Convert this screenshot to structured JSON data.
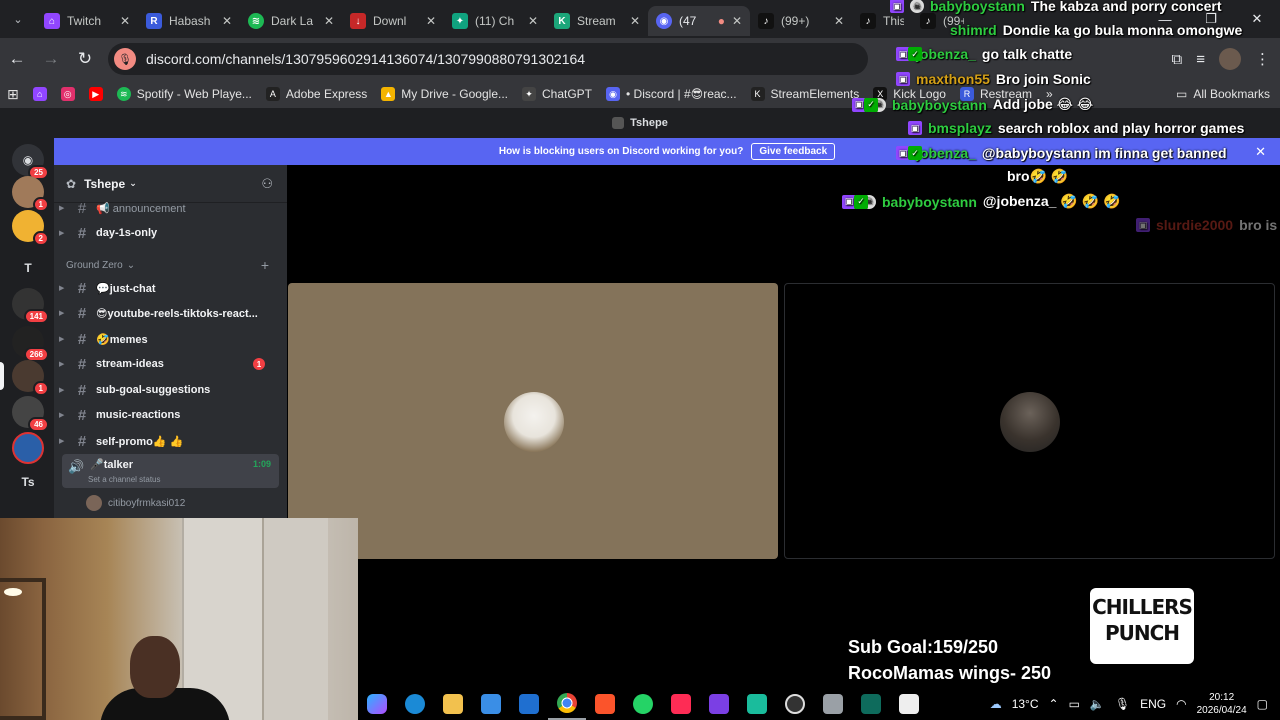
{
  "browser": {
    "tabs": [
      {
        "label": "Twitch",
        "icon": "twitch-icon",
        "color": "#9146ff"
      },
      {
        "label": "Habash",
        "icon": "r-icon",
        "color": "#3b5bdb"
      },
      {
        "label": "Dark La",
        "icon": "spotify-icon",
        "color": "#1db954"
      },
      {
        "label": "Downl",
        "icon": "download-icon",
        "color": "#c62828"
      },
      {
        "label": "(11) Ch",
        "icon": "chatgpt-icon",
        "color": "#10a37f"
      },
      {
        "label": "Stream",
        "icon": "streamelements-icon",
        "color": "#1ca67a"
      },
      {
        "label": "(47",
        "icon": "discord-icon",
        "color": "#5865f2"
      },
      {
        "label": "(99+)",
        "icon": "tiktok-icon",
        "color": "#111111"
      },
      {
        "label": "This th",
        "icon": "tiktok-icon",
        "color": "#111111"
      },
      {
        "label": "(99+)",
        "icon": "tiktok-icon",
        "color": "#111111"
      }
    ],
    "url": "discord.com/channels/1307959602914136074/1307990880791302164",
    "bookmarks": [
      {
        "label": "Spotify - Web Playe...",
        "icon": "spotify-icon",
        "color": "#1db954"
      },
      {
        "label": "Adobe Express",
        "icon": "adobe-icon",
        "color": "#222222"
      },
      {
        "label": "My Drive - Google...",
        "icon": "drive-icon",
        "color": "#f4b400"
      },
      {
        "label": "ChatGPT",
        "icon": "chatgpt-icon",
        "color": "#444444"
      },
      {
        "label": "• Discord | #😎reac...",
        "icon": "discord-icon",
        "color": "#5865f2"
      },
      {
        "label": "StreamElements",
        "icon": "streamelements-icon",
        "color": "#222222"
      },
      {
        "label": "Kick Logo",
        "icon": "x-icon",
        "color": "#111111"
      },
      {
        "label": "Restream",
        "icon": "restream-icon",
        "color": "#3b5bdb"
      }
    ],
    "all_bookmarks": "All Bookmarks"
  },
  "discord": {
    "title": "Tshepe",
    "banner_text": "How is blocking users on Discord working for you?",
    "banner_button": "Give feedback",
    "server_name": "Tshepe",
    "guild_badges": [
      "25",
      "1",
      "2",
      "141",
      "266",
      "1",
      "46"
    ],
    "guild_letters": [
      "T",
      "Ts"
    ],
    "channels_top": [
      {
        "label": "📢 announcement"
      },
      {
        "label": "day-1s-only"
      }
    ],
    "category": "Ground Zero",
    "channels": [
      {
        "label": "💬just-chat"
      },
      {
        "label": "😎youtube-reels-tiktoks-react..."
      },
      {
        "label": "🤣memes"
      },
      {
        "label": "stream-ideas",
        "unread": "1"
      },
      {
        "label": "sub-goal-suggestions"
      },
      {
        "label": "music-reactions"
      },
      {
        "label": "self-promo👍 👍"
      }
    ],
    "voice": {
      "name": "🎤talker",
      "status": "Set a channel status",
      "time": "1:09",
      "user": "citiboyfrmkasi012"
    }
  },
  "chat": [
    {
      "user": "babyboystann",
      "color": "#2ecc40",
      "text": "The kabza and porry concert",
      "badges": [
        "p",
        "w"
      ]
    },
    {
      "user": "shimrd",
      "color": "#2ecc40",
      "text": "Dondie ka go bula monna omongwe",
      "badges": []
    },
    {
      "user": "jobenza_",
      "color": "#2ecc40",
      "text": "go talk chatte",
      "badges": [
        "p",
        "g"
      ]
    },
    {
      "user": "maxthon55",
      "color": "#d4a017",
      "text": "Bro join Sonic",
      "badges": [
        "p"
      ]
    },
    {
      "user": "babyboystann",
      "color": "#2ecc40",
      "text": "Add jobe 😂 😂",
      "badges": [
        "p",
        "g",
        "w"
      ]
    },
    {
      "user": "bmsplayz",
      "color": "#2ecc40",
      "text": "search roblox and play horror games",
      "badges": [
        "p"
      ]
    },
    {
      "user": "jobenza_",
      "color": "#2ecc40",
      "text": "@babyboystann im finna get banned",
      "text2": "bro🤣 🤣",
      "badges": [
        "p",
        "g"
      ]
    },
    {
      "user": "babyboystann",
      "color": "#2ecc40",
      "text": "@jobenza_ 🤣 🤣 🤣",
      "badges": [
        "p",
        "g",
        "w"
      ]
    },
    {
      "user": "slurdie2000",
      "color": "#8b1a1a",
      "text": "bro is",
      "badges": [
        "p"
      ],
      "faded": true
    }
  ],
  "overlay": {
    "sub_goal": "Sub Goal:159/250",
    "goal_item": "RocoMamas wings- 250",
    "logo_line1": "CHILLERS",
    "logo_line2": "PUNCH"
  },
  "taskbar": {
    "weather": "13°C",
    "lang": "ENG",
    "time": "20:12",
    "date": "2026/04/24"
  }
}
